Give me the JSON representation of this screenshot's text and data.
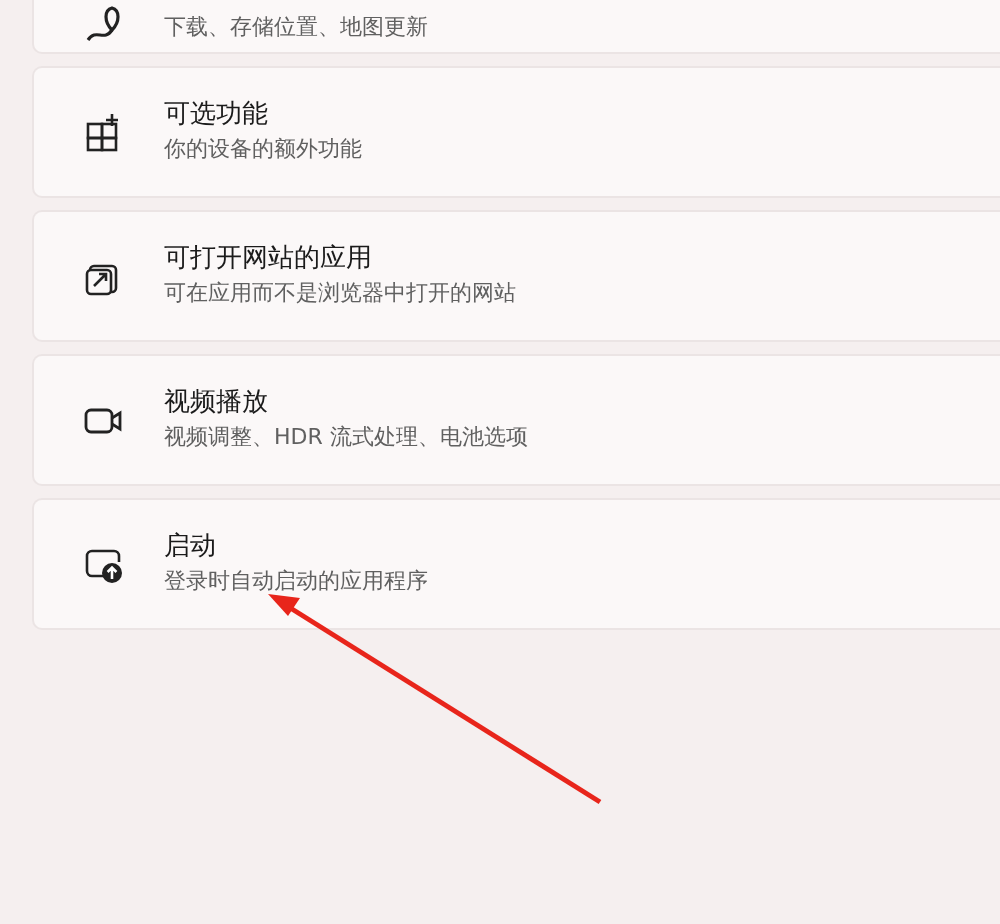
{
  "settings_items": [
    {
      "subtitle": "下载、存储位置、地图更新"
    },
    {
      "title": "可选功能",
      "subtitle": "你的设备的额外功能"
    },
    {
      "title": "可打开网站的应用",
      "subtitle": "可在应用而不是浏览器中打开的网站"
    },
    {
      "title": "视频播放",
      "subtitle": "视频调整、HDR 流式处理、电池选项"
    },
    {
      "title": "启动",
      "subtitle": "登录时自动启动的应用程序"
    }
  ],
  "annotation": {
    "kind": "arrow"
  }
}
